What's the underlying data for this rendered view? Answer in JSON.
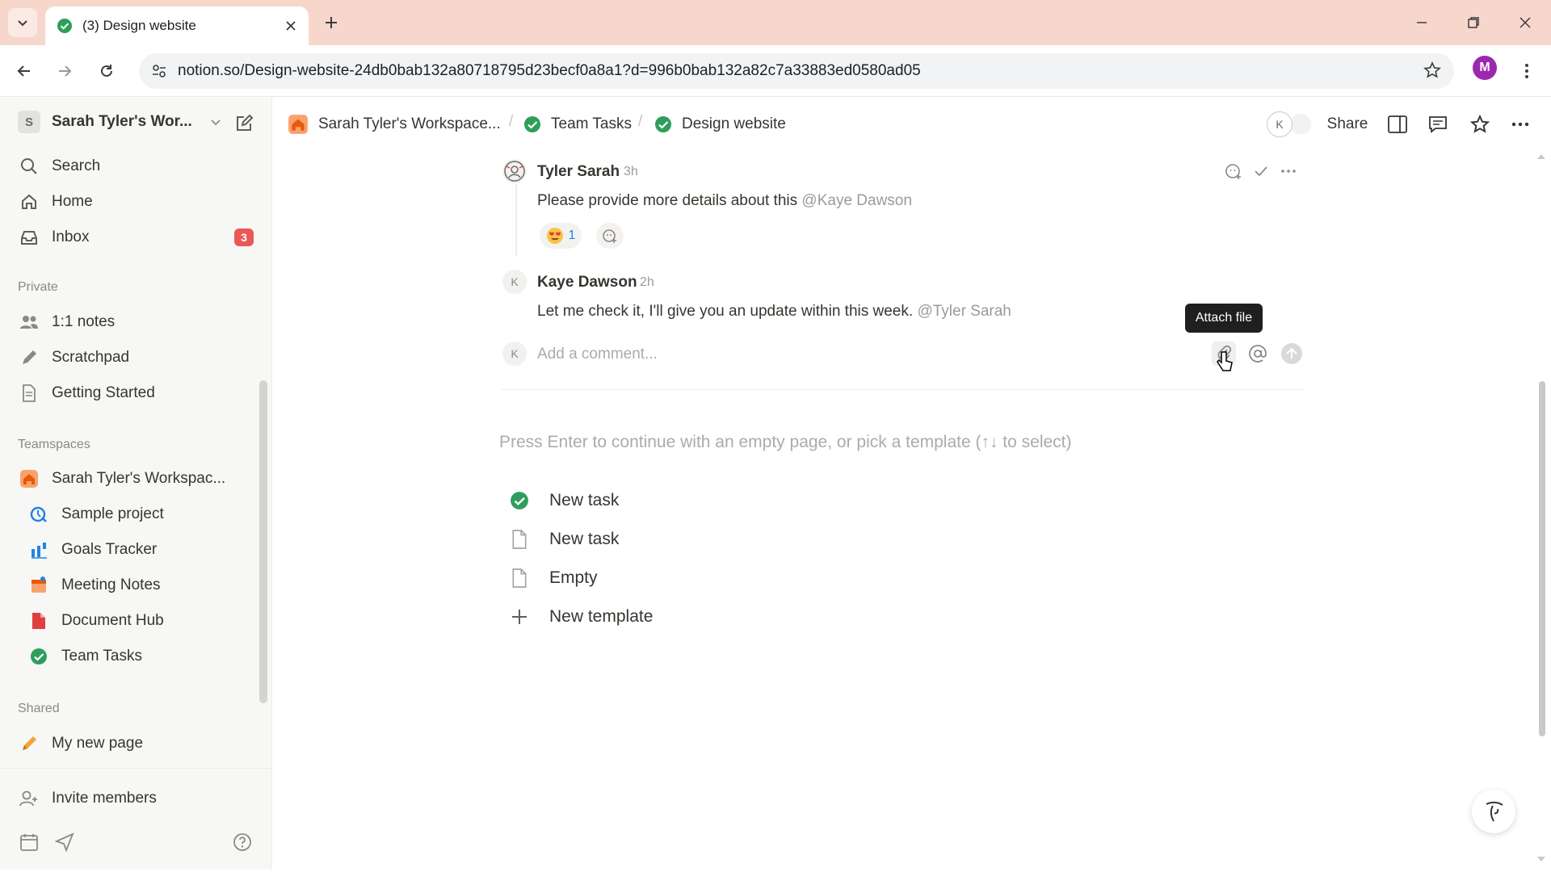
{
  "browser": {
    "tab_title": "(3) Design website",
    "url": "notion.so/Design-website-24db0bab132a80718795d23becf0a8a1?d=996b0bab132a82c7a33883ed0580ad05",
    "profile_initial": "M"
  },
  "sidebar": {
    "workspace_initial": "S",
    "workspace_name": "Sarah Tyler's Wor...",
    "top_items": [
      {
        "label": "Search",
        "icon": "search-icon"
      },
      {
        "label": "Home",
        "icon": "home-icon"
      },
      {
        "label": "Inbox",
        "icon": "inbox-icon",
        "badge": "3"
      }
    ],
    "private_label": "Private",
    "private_items": [
      {
        "label": "1:1 notes",
        "icon": "people-icon"
      },
      {
        "label": "Scratchpad",
        "icon": "pencil-icon"
      },
      {
        "label": "Getting Started",
        "icon": "page-icon"
      }
    ],
    "teamspaces_label": "Teamspaces",
    "teamspace_name": "Sarah Tyler's Workspac...",
    "teamspace_items": [
      {
        "label": "Sample project",
        "icon": "project-icon"
      },
      {
        "label": "Goals Tracker",
        "icon": "chart-icon"
      },
      {
        "label": "Meeting Notes",
        "icon": "calendar-icon"
      },
      {
        "label": "Document Hub",
        "icon": "document-icon"
      },
      {
        "label": "Team Tasks",
        "icon": "check-circle-icon"
      }
    ],
    "shared_label": "Shared",
    "shared_items": [
      {
        "label": "My new page",
        "icon": "pencil-icon"
      }
    ],
    "invite_label": "Invite members"
  },
  "topbar": {
    "breadcrumbs": [
      "Sarah Tyler's Workspace...",
      "Team Tasks",
      "Design website"
    ],
    "presence_initial": "K",
    "share_label": "Share"
  },
  "comments": [
    {
      "author": "Tyler Sarah",
      "time": "3h",
      "text": "Please provide more details about this",
      "mention": "@Kaye Dawson",
      "reaction_count": "1"
    },
    {
      "author": "Kaye Dawson",
      "avatar_initial": "K",
      "time": "2h",
      "text": "Let me check it, I'll give you an update within this week.",
      "mention": "@Tyler Sarah"
    }
  ],
  "composer": {
    "avatar_initial": "K",
    "placeholder": "Add a comment...",
    "tooltip": "Attach file"
  },
  "template_picker": {
    "hint": "Press Enter to continue with an empty page, or pick a template (↑↓ to select)",
    "options": [
      {
        "label": "New task",
        "icon": "check-circle-icon"
      },
      {
        "label": "New task",
        "icon": "page-icon"
      },
      {
        "label": "Empty",
        "icon": "page-icon"
      },
      {
        "label": "New template",
        "icon": "plus-icon"
      }
    ]
  },
  "colors": {
    "tab_strip": "#f7d7cc",
    "sidebar_bg": "#f7f7f5",
    "badge": "#eb5757",
    "check_green": "#2f9e5b",
    "tooltip_bg": "#1f1f1f"
  }
}
